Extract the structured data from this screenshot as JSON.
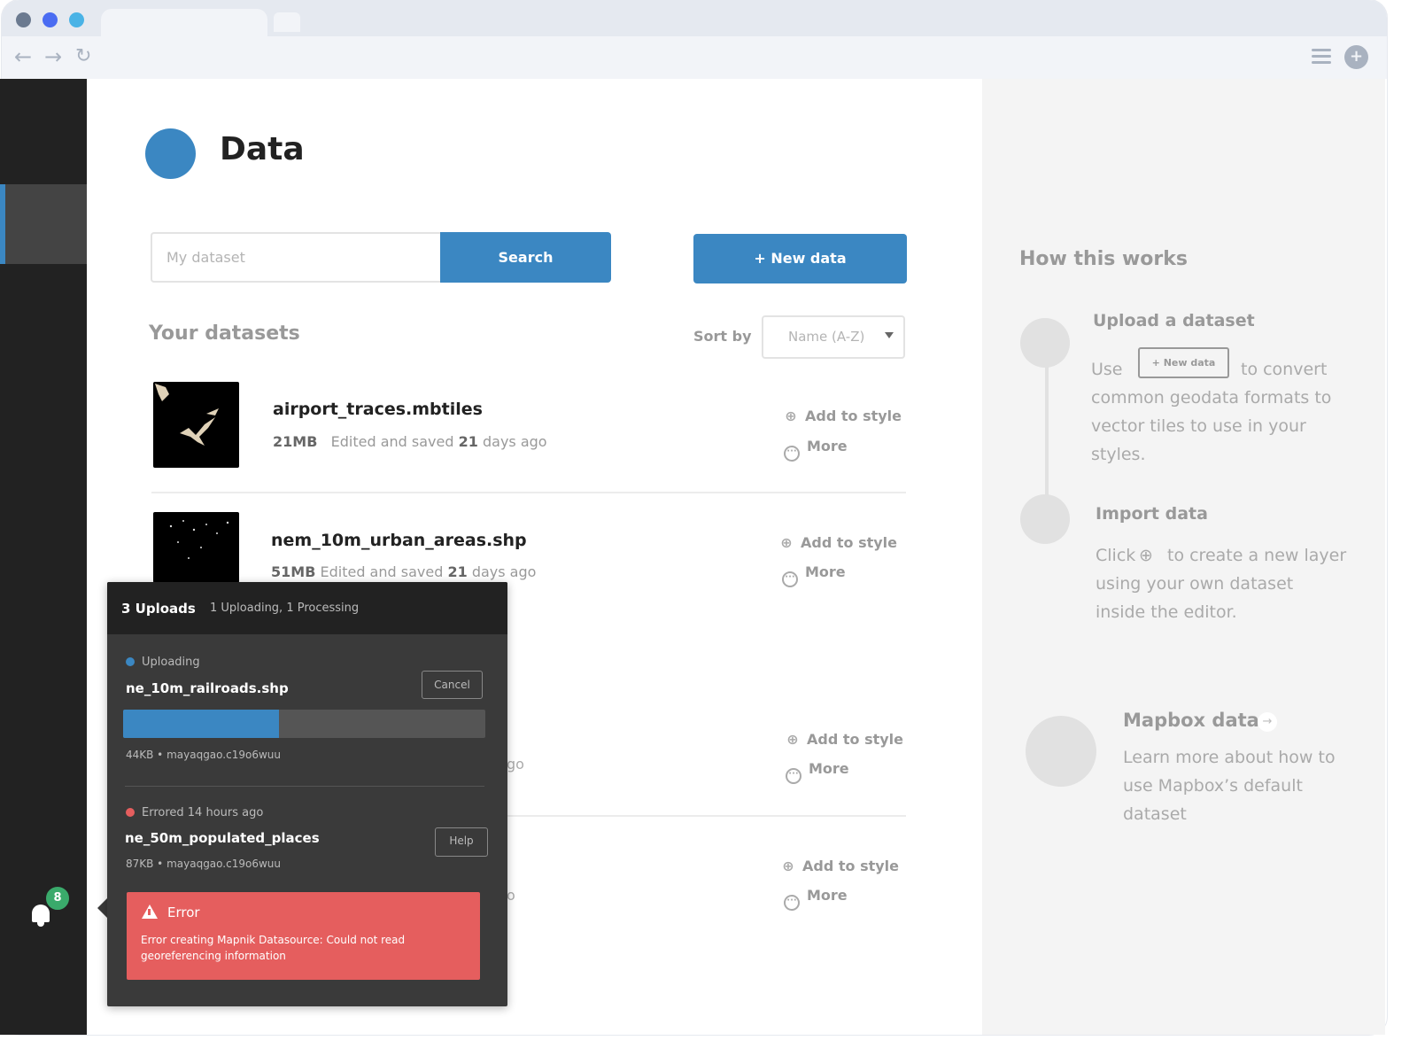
{
  "main": {
    "title": "Data",
    "search": {
      "placeholder": "My dataset",
      "button": "Search"
    },
    "new_data_button": "+ New data",
    "section_title": "Your datasets",
    "sort": {
      "label": "Sort by",
      "value": "Name (A-Z)"
    },
    "datasets": [
      {
        "name": "airport_traces.mbtiles",
        "size": "21MB",
        "edited_prefix": "Edited and saved",
        "edited_days": "21",
        "edited_suffix": "days ago",
        "add_to_style": "Add to style",
        "more": "More"
      },
      {
        "name": "nem_10m_urban_areas.shp",
        "size": "51MB",
        "edited_prefix": "Edited and saved",
        "edited_days": "21",
        "edited_suffix": "days ago",
        "add_to_style": "Add to style",
        "more": "More"
      },
      {
        "add_to_style": "Add to style",
        "more": "More",
        "partial_meta": "go"
      },
      {
        "add_to_style": "Add to style",
        "more": "More",
        "partial_meta": "o"
      }
    ]
  },
  "help": {
    "title": "How this works",
    "steps": [
      {
        "heading": "Upload a dataset",
        "text_before": "Use",
        "inline_button": "+ New data",
        "text_after": "to convert",
        "text_rest": "common geodata formats to vector tiles to use in your styles."
      },
      {
        "heading": "Import data",
        "text_before": "Click",
        "text_after": "to create a new layer",
        "text_rest": "using your own dataset inside the editor."
      }
    ],
    "mapbox": {
      "heading": "Mapbox data",
      "text": "Learn more about how to use Mapbox’s default dataset"
    }
  },
  "uploads": {
    "title": "3 Uploads",
    "summary": "1 Uploading, 1 Processing",
    "items": [
      {
        "status": "Uploading",
        "status_color": "#3b87c2",
        "name": "ne_10m_railroads.shp",
        "button": "Cancel",
        "progress": 0.43,
        "meta": "44KB • mayaqgao.c19o6wuu"
      },
      {
        "status": "Errored 14 hours ago",
        "status_color": "#e55e5e",
        "name": "ne_50m_populated_places",
        "button": "Help",
        "meta": "87KB • mayaqgao.c19o6wuu",
        "error_title": "Error",
        "error_message": "Error creating Mapnik Datasource: Could not read georeferencing information"
      }
    ]
  },
  "sidebar": {
    "notification_count": "8"
  },
  "colors": {
    "accent": "#3b87c2",
    "error": "#e55e5e",
    "success_badge": "#3aaa6b",
    "sidebar": "#222222"
  },
  "icons": [
    "back-arrow-icon",
    "forward-arrow-icon",
    "reload-icon",
    "menu-icon",
    "extension-icon",
    "bell-icon",
    "add-to-style-icon",
    "more-icon",
    "warning-icon",
    "arrow-right-icon",
    "dropdown-caret-icon"
  ]
}
